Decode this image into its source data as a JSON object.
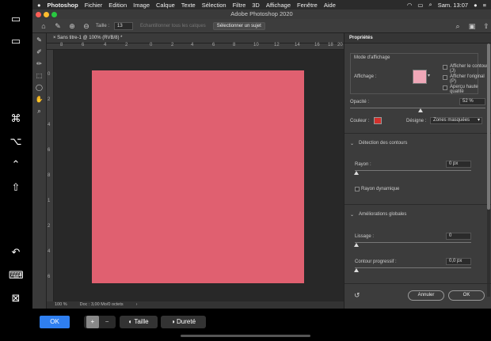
{
  "sidecar": {
    "icons": [
      "menu-bar-icon",
      "dock-icon",
      "command-icon",
      "option-icon",
      "control-icon",
      "shift-icon",
      "undo-icon",
      "keyboard-icon",
      "disconnect-icon"
    ]
  },
  "menubar": {
    "apple": "",
    "app": "Photoshop",
    "items": [
      "Fichier",
      "Edition",
      "Image",
      "Calque",
      "Texte",
      "Sélection",
      "Filtre",
      "3D",
      "Affichage",
      "Fenêtre",
      "Aide"
    ],
    "clock": "Sam. 13:07"
  },
  "window": {
    "title": "Adobe Photoshop 2020"
  },
  "options": {
    "size_label": "Taille :",
    "size_value": "13",
    "refine_label": "Echantillonner tous les calques",
    "select_subject_label": "Sélectionner un sujet"
  },
  "document": {
    "tab_title": "Sans titre-1 @ 100% (RVB/8) *",
    "ruler_h": [
      "8",
      "6",
      "4",
      "2",
      "0",
      "2",
      "4",
      "6",
      "8",
      "10",
      "12",
      "14",
      "16",
      "18",
      "20"
    ],
    "ruler_v": [
      "0",
      "2",
      "4",
      "6",
      "8",
      "1",
      "2",
      "4",
      "6"
    ],
    "zoom": "100 %",
    "doc_info": "Doc : 3,00 Mo/0 octets",
    "canvas_color": "#e06070"
  },
  "properties": {
    "title": "Propriétés",
    "view_mode_label": "Mode d'affichage",
    "display_label": "Affichage :",
    "show_edge": "Afficher le contour (J)",
    "show_original": "Afficher l'original (P)",
    "high_quality": "Aperçu haute qualité",
    "opacity_label": "Opacité :",
    "opacity_value": "52 %",
    "opacity_fraction": 0.52,
    "color_label": "Couleur :",
    "indicates_label": "Désigne :",
    "indicates_value": "Zones masquées",
    "edge_detection_title": "Détection des contours",
    "radius_label": "Rayon :",
    "radius_value": "0 px",
    "smart_radius": "Rayon dynamique",
    "global_title": "Améliorations globales",
    "smooth_label": "Lissage :",
    "smooth_value": "0",
    "feather_label": "Contour progressif :",
    "feather_value": "0,0 px",
    "cancel": "Annuler",
    "ok": "OK"
  },
  "touchbar": {
    "ok": "OK",
    "size": "Taille",
    "hardness": "Dureté"
  }
}
